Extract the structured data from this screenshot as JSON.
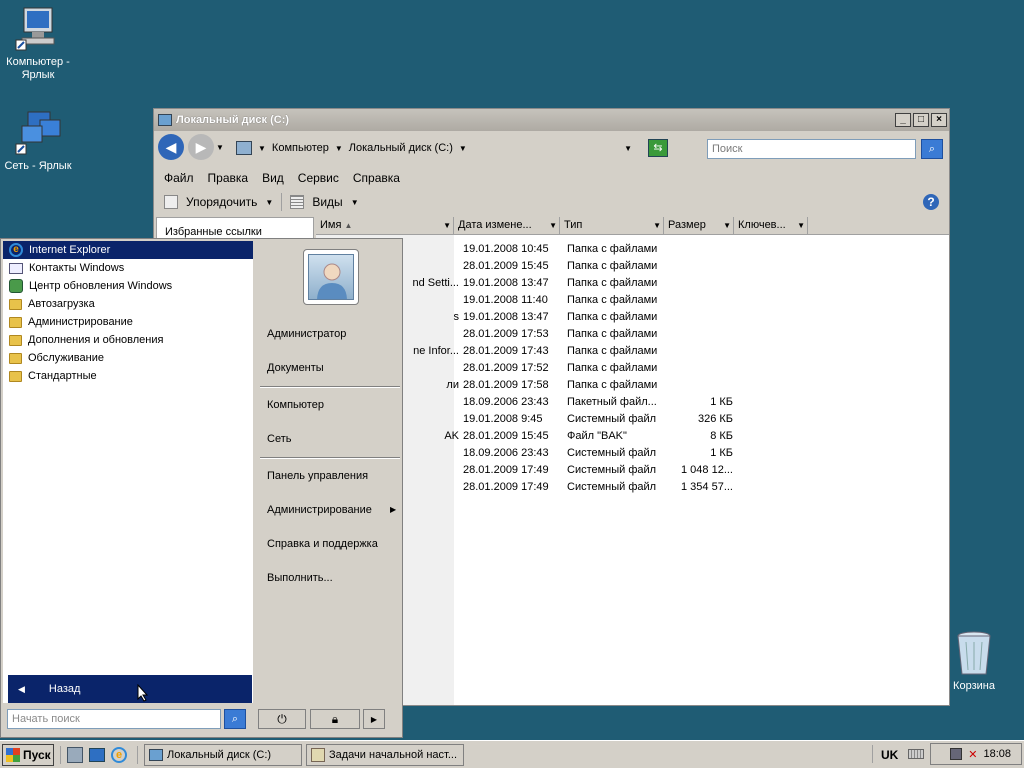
{
  "desktop": {
    "icons": [
      {
        "label": "Компьютер - Ярлык"
      },
      {
        "label": "Сеть - Ярлык"
      },
      {
        "label": "Корзина"
      }
    ]
  },
  "explorer": {
    "title": "Локальный диск (C:)",
    "address": [
      "Компьютер",
      "Локальный диск (C:)"
    ],
    "search_placeholder": "Поиск",
    "menu": [
      "Файл",
      "Правка",
      "Вид",
      "Сервис",
      "Справка"
    ],
    "toolbar": {
      "organize": "Упорядочить",
      "views": "Виды"
    },
    "nav_header": "Избранные ссылки",
    "columns": [
      "Имя",
      "Дата измене...",
      "Тип",
      "Размер",
      "Ключев..."
    ],
    "rows": [
      {
        "name": "",
        "date": "19.01.2008 10:45",
        "type": "Папка с файлами",
        "size": ""
      },
      {
        "name": "",
        "date": "28.01.2009 15:45",
        "type": "Папка с файлами",
        "size": ""
      },
      {
        "name": "nd Setti...",
        "date": "19.01.2008 13:47",
        "type": "Папка с файлами",
        "size": ""
      },
      {
        "name": "",
        "date": "19.01.2008 11:40",
        "type": "Папка с файлами",
        "size": ""
      },
      {
        "name": "s",
        "date": "19.01.2008 13:47",
        "type": "Папка с файлами",
        "size": ""
      },
      {
        "name": "",
        "date": "28.01.2009 17:53",
        "type": "Папка с файлами",
        "size": ""
      },
      {
        "name": "ne Infor...",
        "date": "28.01.2009 17:43",
        "type": "Папка с файлами",
        "size": ""
      },
      {
        "name": "",
        "date": "28.01.2009 17:52",
        "type": "Папка с файлами",
        "size": ""
      },
      {
        "name": "ли",
        "date": "28.01.2009 17:58",
        "type": "Папка с файлами",
        "size": ""
      },
      {
        "name": "",
        "date": "18.09.2006 23:43",
        "type": "Пакетный файл...",
        "size": "1 КБ"
      },
      {
        "name": "",
        "date": "19.01.2008 9:45",
        "type": "Системный файл",
        "size": "326 КБ"
      },
      {
        "name": "AK",
        "date": "28.01.2009 15:45",
        "type": "Файл \"BAK\"",
        "size": "8 КБ"
      },
      {
        "name": "",
        "date": "18.09.2006 23:43",
        "type": "Системный файл",
        "size": "1 КБ"
      },
      {
        "name": "",
        "date": "28.01.2009 17:49",
        "type": "Системный файл",
        "size": "1 048 12..."
      },
      {
        "name": "",
        "date": "28.01.2009 17:49",
        "type": "Системный файл",
        "size": "1 354 57..."
      }
    ]
  },
  "startmenu": {
    "programs": [
      {
        "label": "Internet Explorer",
        "icon": "ie-icon"
      },
      {
        "label": "Контакты Windows",
        "icon": "contacts-icon"
      },
      {
        "label": "Центр обновления Windows",
        "icon": "update-icon"
      },
      {
        "label": "Автозагрузка",
        "icon": "folder-icon"
      },
      {
        "label": "Администрирование",
        "icon": "folder-icon"
      },
      {
        "label": "Дополнения и обновления",
        "icon": "folder-icon"
      },
      {
        "label": "Обслуживание",
        "icon": "folder-icon"
      },
      {
        "label": "Стандартные",
        "icon": "folder-icon"
      }
    ],
    "back": "Назад",
    "right": [
      "Администратор",
      "Документы",
      "Компьютер",
      "Сеть",
      "Панель управления",
      "Администрирование",
      "Справка и поддержка",
      "Выполнить..."
    ],
    "search_placeholder": "Начать поиск"
  },
  "taskbar": {
    "start": "Пуск",
    "tasks": [
      "Локальный диск (C:)",
      "Задачи начальной наст..."
    ],
    "lang": "UK",
    "clock": "18:08"
  }
}
